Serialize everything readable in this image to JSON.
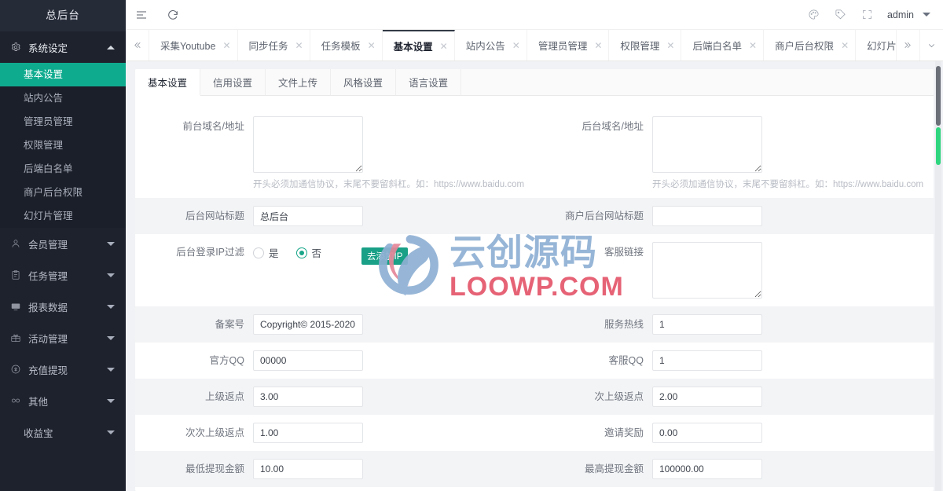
{
  "sidebar": {
    "logo": "总后台",
    "groups": [
      {
        "label": "系统设定",
        "icon": "gear-icon",
        "open": true,
        "items": [
          {
            "label": "基本设置",
            "active": true
          },
          {
            "label": "站内公告",
            "active": false
          },
          {
            "label": "管理员管理",
            "active": false
          },
          {
            "label": "权限管理",
            "active": false
          },
          {
            "label": "后端白名单",
            "active": false
          },
          {
            "label": "商户后台权限",
            "active": false
          },
          {
            "label": "幻灯片管理",
            "active": false
          }
        ]
      },
      {
        "label": "会员管理",
        "icon": "user-icon",
        "open": false,
        "items": []
      },
      {
        "label": "任务管理",
        "icon": "clipboard-icon",
        "open": false,
        "items": []
      },
      {
        "label": "报表数据",
        "icon": "chart-icon",
        "open": false,
        "items": []
      },
      {
        "label": "活动管理",
        "icon": "gift-icon",
        "open": false,
        "items": []
      },
      {
        "label": "充值提现",
        "icon": "coin-icon",
        "open": false,
        "items": []
      },
      {
        "label": "其他",
        "icon": "link-icon",
        "open": false,
        "items": []
      }
    ],
    "plain_item": "收益宝"
  },
  "topbar": {
    "menu_toggle": "menu-fold-icon",
    "refresh": "refresh-icon",
    "icons": [
      "palette-icon",
      "tag-icon",
      "fullscreen-icon"
    ],
    "user": "admin"
  },
  "tabs": {
    "prev_label": "«",
    "next_label": "»",
    "dropdown_label": "⌄",
    "items": [
      {
        "label": "采集Youtube",
        "active": false,
        "closable": true
      },
      {
        "label": "同步任务",
        "active": false,
        "closable": true
      },
      {
        "label": "任务模板",
        "active": false,
        "closable": true
      },
      {
        "label": "基本设置",
        "active": true,
        "closable": true
      },
      {
        "label": "站内公告",
        "active": false,
        "closable": true
      },
      {
        "label": "管理员管理",
        "active": false,
        "closable": true
      },
      {
        "label": "权限管理",
        "active": false,
        "closable": true
      },
      {
        "label": "后端白名单",
        "active": false,
        "closable": true
      },
      {
        "label": "商户后台权限",
        "active": false,
        "closable": true
      },
      {
        "label": "幻灯片管理",
        "active": false,
        "closable": true
      }
    ]
  },
  "subtabs": [
    {
      "label": "基本设置",
      "active": true
    },
    {
      "label": "信用设置",
      "active": false
    },
    {
      "label": "文件上传",
      "active": false
    },
    {
      "label": "风格设置",
      "active": false
    },
    {
      "label": "语言设置",
      "active": false
    }
  ],
  "form": {
    "r1": {
      "left_label": "前台域名/地址",
      "left_value": "",
      "left_hint": "开头必须加通信协议，末尾不要留斜杠。如：https://www.baidu.com",
      "right_label": "后台域名/地址",
      "right_value": "",
      "right_hint": "开头必须加通信协议，末尾不要留斜杠。如：https://www.baidu.com"
    },
    "r2": {
      "left_label": "后台网站标题",
      "left_value": "总后台",
      "right_label": "商户后台网站标题",
      "right_value": ""
    },
    "r3": {
      "left_label": "后台登录IP过滤",
      "radio_yes": "是",
      "radio_no": "否",
      "selected": "否",
      "button": "去添加IP",
      "right_label": "客服链接",
      "right_value": ""
    },
    "r4": {
      "left_label": "备案号",
      "left_value": "Copyright© 2015-2020",
      "right_label": "服务热线",
      "right_value": "1"
    },
    "r5": {
      "left_label": "官方QQ",
      "left_value": "00000",
      "right_label": "客服QQ",
      "right_value": "1"
    },
    "r6": {
      "left_label": "上级返点",
      "left_value": "3.00",
      "right_label": "次上级返点",
      "right_value": "2.00"
    },
    "r7": {
      "left_label": "次次上级返点",
      "left_value": "1.00",
      "right_label": "邀请奖励",
      "right_value": "0.00"
    },
    "r8": {
      "left_label": "最低提现金额",
      "left_value": "10.00",
      "right_label": "最高提现金额",
      "right_value": "100000.00"
    }
  },
  "watermark": {
    "cn": "云创源码",
    "en": "LOOWP.COM"
  },
  "colors": {
    "sidebar_bg": "#1e222d",
    "active_green": "#0fab8f",
    "button_green": "#19a086",
    "scroll_green": "#2fd67f"
  }
}
